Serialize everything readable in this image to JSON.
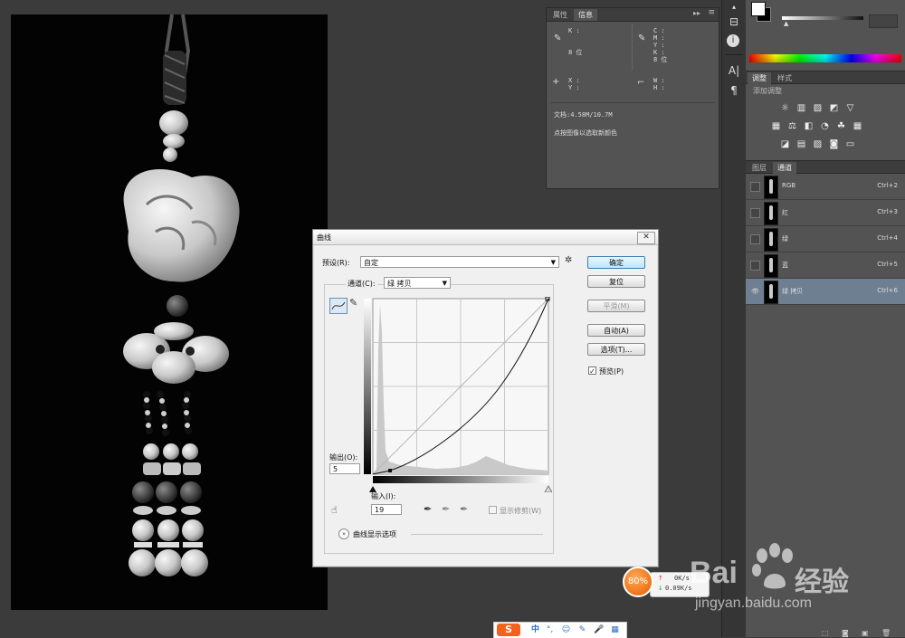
{
  "info_panel": {
    "tabs": [
      "属性",
      "信息"
    ],
    "k_block": "K :\n\n\n8 位",
    "cmyk_block": "C :\nM :\nY :\nK :\n8 位",
    "xy_block": "X :\nY :",
    "wh_block": "W :\nH :",
    "doc_size": "文档:4.58M/10.7M",
    "hint": "点按图像以选取新颜色"
  },
  "right_panel": {
    "adjust_tabs": [
      "调整",
      "样式"
    ],
    "add_adjustment": "添加调整",
    "layer_tabs": [
      "图层",
      "通道"
    ],
    "channels": [
      {
        "name": "RGB",
        "shortcut": "Ctrl+2",
        "visible": false,
        "selected": false
      },
      {
        "name": "红",
        "shortcut": "Ctrl+3",
        "visible": false,
        "selected": false
      },
      {
        "name": "绿",
        "shortcut": "Ctrl+4",
        "visible": false,
        "selected": false
      },
      {
        "name": "蓝",
        "shortcut": "Ctrl+5",
        "visible": false,
        "selected": false
      },
      {
        "name": "绿 拷贝",
        "shortcut": "Ctrl+6",
        "visible": true,
        "selected": true
      }
    ]
  },
  "curves": {
    "title": "曲线",
    "preset_label": "预设(R):",
    "preset_value": "自定",
    "channel_label": "通道(C):",
    "channel_value": "绿 拷贝",
    "output_label": "输出(O):",
    "output_value": "5",
    "input_label": "输入(I):",
    "input_value": "19",
    "show_clipping": "显示修剪(W)",
    "show_options": "曲线显示选项",
    "buttons": {
      "ok": "确定",
      "reset": "复位",
      "smooth": "平滑(M)",
      "auto": "自动(A)",
      "options": "选项(T)..."
    },
    "preview_label": "预览(P)",
    "preview_checked": true
  },
  "network": {
    "percent": "80%",
    "up": "0K/s",
    "down": "0.09K/s"
  },
  "watermark": {
    "brand": "Bai",
    "brand2": "经验",
    "url": "jingyan.baidu.com"
  },
  "ime": {
    "lang": "中"
  },
  "colors": {
    "accent": "#4f83b6",
    "selected_row": "#6f7f92",
    "orange": "#f07c1e"
  }
}
